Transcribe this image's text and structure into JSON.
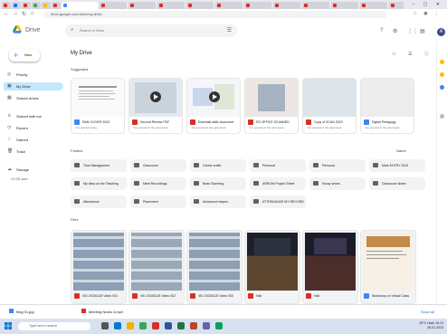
{
  "browser": {
    "url": "drive.google.com/drive/my-drive",
    "window_controls": "–  ▢  ✕"
  },
  "header": {
    "app_name": "Drive",
    "search_placeholder": "Search in Drive",
    "avatar_letter": "A"
  },
  "sidebar": {
    "new_label": "New",
    "items": [
      {
        "label": "Priority",
        "icon": "check-circle-icon"
      },
      {
        "label": "My Drive",
        "icon": "drive-icon"
      },
      {
        "label": "Shared drives",
        "icon": "shared-drives-icon"
      },
      {
        "label": "Shared with me",
        "icon": "people-icon"
      },
      {
        "label": "Recent",
        "icon": "clock-icon"
      },
      {
        "label": "Starred",
        "icon": "star-icon"
      },
      {
        "label": "Trash",
        "icon": "trash-icon"
      },
      {
        "label": "Storage",
        "icon": "cloud-icon"
      }
    ],
    "storage_text": "10 GB used"
  },
  "main": {
    "title": "My Drive",
    "suggested_label": "Suggested",
    "folders_label": "Folders",
    "files_label": "Files",
    "sort_label": "Name",
    "suggested": [
      {
        "name": "RAM COVER 2023",
        "sub": "You opened today"
      },
      {
        "name": "Second Review PDF",
        "sub": "You opened in the past week"
      },
      {
        "name": "Essential skills document",
        "sub": "You opened in the past week"
      },
      {
        "name": "RS OFFICE SCANNED",
        "sub": "You opened in the past week"
      },
      {
        "name": "Copy of SCAN 2023",
        "sub": "You opened in the past week"
      },
      {
        "name": "Digital Pedagogy",
        "sub": "You opened in the past week"
      }
    ],
    "folders": [
      "Time Management",
      "Classroom",
      "Career crafts",
      "Personal",
      "Personal",
      "Mark ENTRY 2023",
      "My diary on the Teaching",
      "Meet Recordings",
      "Brain Storming",
      "ARROW Project Sheet",
      "Essay series",
      "Classroom Notes",
      "Attendance",
      "Placement",
      "Advanced recipes",
      "ATTENDANCE MY RECORDS"
    ],
    "files": [
      {
        "name": "VID 20230125 Video 001"
      },
      {
        "name": "VID 20230125 Video 002"
      },
      {
        "name": "VID 20230125 Video 003"
      },
      {
        "name": "Hall"
      },
      {
        "name": "Hall"
      },
      {
        "name": "Workshop on Virtual Class"
      }
    ]
  },
  "downloads": {
    "items": [
      "Msg 01.jpg",
      "Meeting Notes 4.mp4"
    ],
    "show_all": "Show all"
  },
  "taskbar": {
    "search_placeholder": "Type here to search",
    "time": "10:24",
    "date": "25-01-2023",
    "weather": "28°C Haze"
  }
}
